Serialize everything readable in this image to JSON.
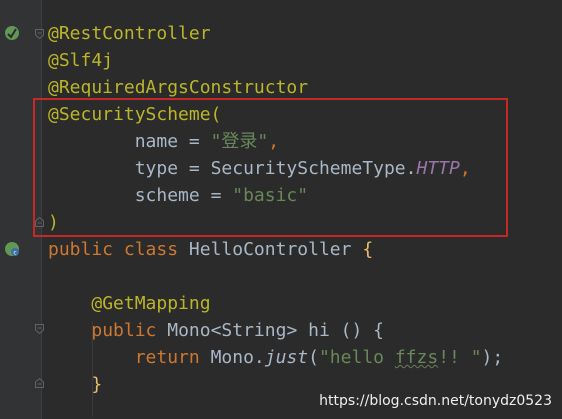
{
  "editor": {
    "line1_text": "@RestController",
    "line2_text": "@Slf4j",
    "line3_text": "@RequiredArgsConstructor",
    "line4_text": "@SecurityScheme(",
    "line5_indent": "        ",
    "line5_name_key": "name",
    "line5_equals": " = ",
    "line5_name_value": "\"登录\"",
    "line5_comma": ",",
    "line6_indent": "        ",
    "line6_type_key": "type",
    "line6_equals": " = ",
    "line6_type_class": "SecuritySchemeType.",
    "line6_type_const": "HTTP",
    "line6_comma": ",",
    "line7_indent": "        ",
    "line7_scheme_key": "scheme",
    "line7_equals": " = ",
    "line7_scheme_value": "\"basic\"",
    "line8_text": ")",
    "line9_public": "public",
    "line9_class": "class",
    "line9_name": "HelloController",
    "line9_brace": "{",
    "line11_indent": "    ",
    "line11_annotation": "@GetMapping",
    "line12_indent": "    ",
    "line12_public": "public",
    "line12_type": "Mono<String>",
    "line12_sig": "hi () {",
    "line13_indent": "        ",
    "line13_return": "return",
    "line13_mono": "Mono.",
    "line13_just": "just",
    "line13_paren_open": "(",
    "line13_str_prefix": "\"hello ",
    "line13_str_typo": "ffzs",
    "line13_str_suffix": "!! \"",
    "line13_end": ");",
    "line14_indent": "    ",
    "line14_brace": "}"
  },
  "watermark": "https://blog.csdn.net/tonydz0523",
  "colors": {
    "background": "#2b2b2b",
    "gutter": "#313335",
    "annotation": "#bbb529",
    "keyword": "#cc7832",
    "string": "#6a8759",
    "constant": "#9876aa",
    "text": "#a9b7c6",
    "highlight_box": "#c62828"
  },
  "icons": {
    "bean_icon": "spring-bean-icon",
    "class_icon": "spring-class-icon",
    "fold_icon": "fold-marker-icon"
  }
}
